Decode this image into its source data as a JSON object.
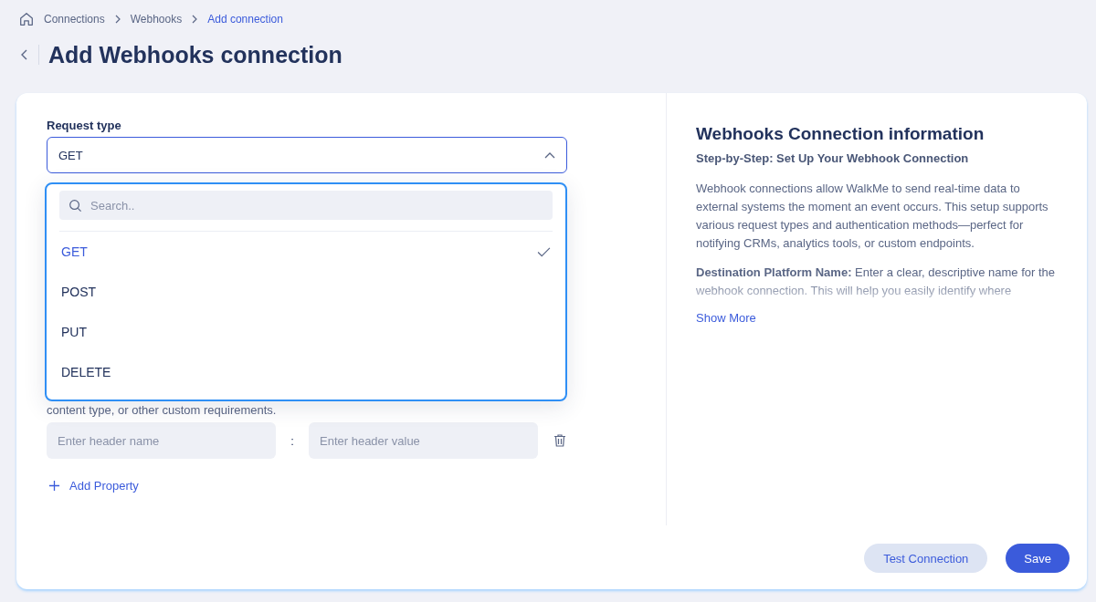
{
  "breadcrumbs": [
    {
      "label": "Connections",
      "current": false
    },
    {
      "label": "Webhooks",
      "current": false
    },
    {
      "label": "Add connection",
      "current": true
    }
  ],
  "title": "Add Webhooks connection",
  "form": {
    "request_type": {
      "label": "Request type",
      "value": "GET",
      "expanded": true
    },
    "dropdown": {
      "search_placeholder": "Search..",
      "options": [
        {
          "label": "GET",
          "selected": true
        },
        {
          "label": "POST",
          "selected": false
        },
        {
          "label": "PUT",
          "selected": false
        },
        {
          "label": "DELETE",
          "selected": false
        }
      ]
    },
    "headers_hint": "content type, or other custom requirements.",
    "header_row": {
      "name_placeholder": "Enter header name",
      "separator": ":",
      "value_placeholder": "Enter header value"
    },
    "add_property": "Add Property"
  },
  "info": {
    "title": "Webhooks Connection information",
    "subtitle": "Step-by-Step: Set Up Your Webhook Connection",
    "paragraphs": [
      "Webhook connections allow WalkMe to send real-time data to external systems the moment an event occurs. This setup supports various request types and authentication methods—perfect for notifying CRMs, analytics tools, or custom endpoints.",
      "**Destination Platform Name:** Enter a clear, descriptive name for the webhook connection. This will help you easily identify where"
    ],
    "show_more": "Show More"
  },
  "buttons": {
    "test": "Test Connection",
    "save": "Save"
  }
}
